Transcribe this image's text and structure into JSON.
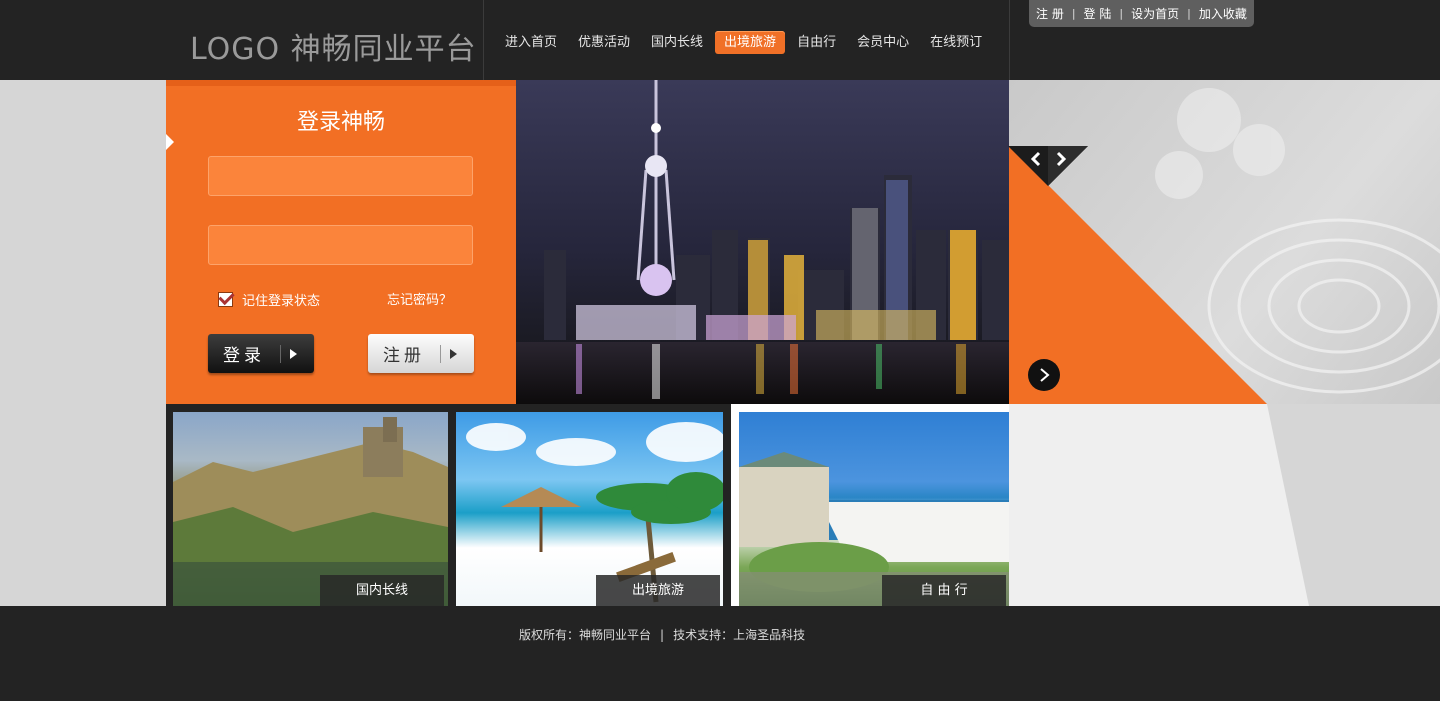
{
  "header": {
    "logo_text": "LOGO 神畅同业平台",
    "nav": [
      "进入首页",
      "优惠活动",
      "国内长线",
      "出境旅游",
      "自由行",
      "会员中心",
      "在线预订"
    ],
    "active_nav": "出境旅游",
    "toplinks": [
      "注 册",
      "登 陆",
      "设为首页",
      "加入收藏"
    ],
    "toplink_separator": "|"
  },
  "login": {
    "title": "登录神畅",
    "username_value": "",
    "password_value": "",
    "remember_label": "记住登录状态",
    "remember_checked": true,
    "forgot_label": "忘记密码？",
    "login_button": "登录",
    "register_button": "注册"
  },
  "thumbnails": [
    {
      "label": "国内长线"
    },
    {
      "label": "出境旅游"
    },
    {
      "label": "自 由 行"
    }
  ],
  "footer": {
    "copyright_label": "版权所有：神畅同业平台",
    "separator": "|",
    "support_label": "技术支持：上海圣品科技"
  },
  "colors": {
    "accent": "#f26f24",
    "dark": "#232323",
    "light_bg": "#d6d6d6"
  },
  "icons": [
    "prev-arrow-icon",
    "next-arrow-icon",
    "next-circle-icon",
    "play-arrow-icon",
    "checkbox-checked-icon"
  ]
}
